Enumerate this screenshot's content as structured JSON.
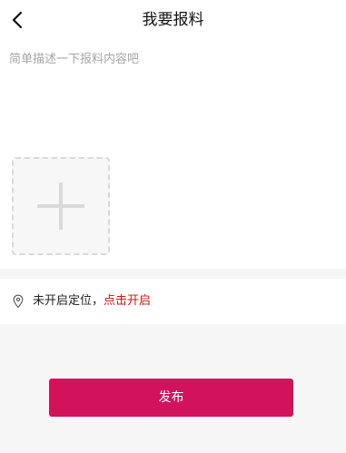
{
  "header": {
    "back_icon": "chevron-left-icon",
    "title": "我要报料"
  },
  "report": {
    "placeholder": "简单描述一下报料内容吧",
    "value": ""
  },
  "media": {
    "add_icon": "plus-icon"
  },
  "location": {
    "icon": "location-pin-icon",
    "status_text": "未开启定位，",
    "enable_link": "点击开启"
  },
  "actions": {
    "publish_label": "发布"
  },
  "colors": {
    "accent": "#d3125c",
    "link": "#d01414",
    "page_background": "#f6f6f6"
  }
}
